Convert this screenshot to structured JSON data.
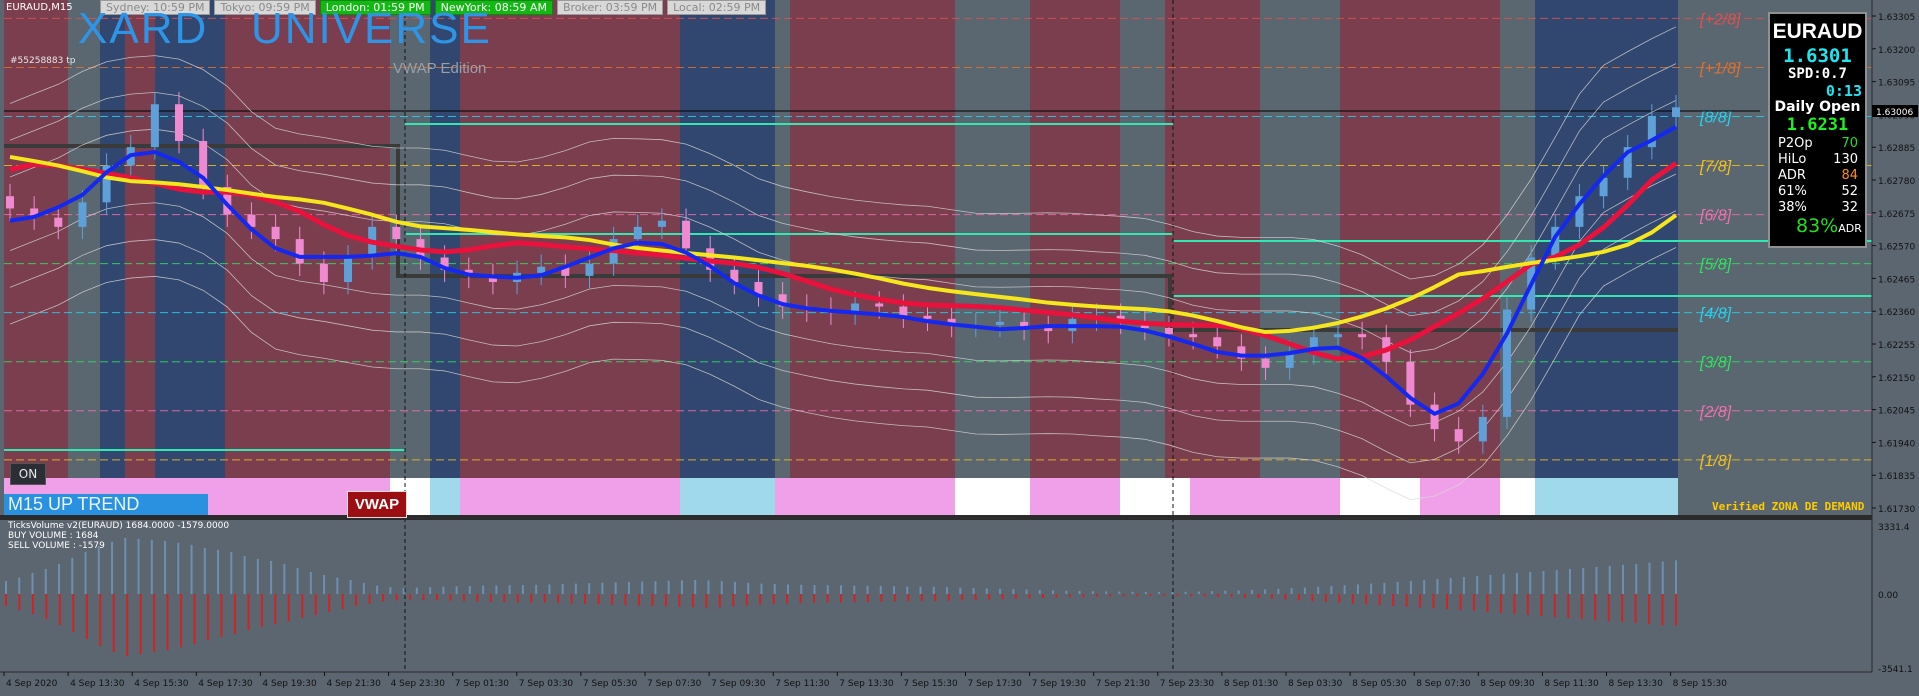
{
  "window": {
    "symbol_title": "EURAUD,M15",
    "brand_left": "XARD",
    "brand_right": "UNIVERSE",
    "brand_subtitle": "VWAP Edition",
    "account_label": "#55258883 tp",
    "on_button": "ON",
    "trend_label": "M15   UP TREND",
    "vwap_badge": "VWAP",
    "demand_label": "Verified ZONA DE DEMAND"
  },
  "sessions": [
    {
      "label": "Sydney: 10:59 PM",
      "active": false
    },
    {
      "label": "Tokyo: 09:59 PM",
      "active": false
    },
    {
      "label": "London: 01:59 PM",
      "active": true
    },
    {
      "label": "NewYork: 08:59 AM",
      "active": true
    },
    {
      "label": "Broker: 03:59 PM",
      "active": false
    },
    {
      "label": "Local: 02:59 PM",
      "active": false
    }
  ],
  "info_panel": {
    "symbol": "EURAUD",
    "price": "1.6301",
    "spread": "SPD:0.7",
    "time": "0:13",
    "daily_open_label": "Daily Open",
    "daily_open": "1.6231",
    "rows": [
      {
        "key": "P2Op",
        "value": "70",
        "color": "#20e020"
      },
      {
        "key": "HiLo",
        "value": "130",
        "color": "#ffffff"
      },
      {
        "key": "ADR",
        "value": "84",
        "color": "#ff8c1a"
      },
      {
        "key": "61%",
        "value": "52",
        "color": "#ffffff"
      },
      {
        "key": "38%",
        "value": "32",
        "color": "#ffffff"
      }
    ],
    "adr_pct": "83%",
    "adr_suffix": "ADR"
  },
  "chart_data": [
    {
      "type": "candlestick",
      "symbol": "EURAUD",
      "timeframe": "M15",
      "y_ticks": [
        "1.63305",
        "1.63200",
        "1.63095",
        "1.62990",
        "1.62885",
        "1.62780",
        "1.62675",
        "1.62570",
        "1.62465",
        "1.62360",
        "1.62255",
        "1.62150",
        "1.62045",
        "1.61940",
        "1.61835",
        "1.61730"
      ],
      "ylim": [
        1.6168,
        1.6336
      ],
      "current_price_tag": "1.63006",
      "x_ticks": [
        "4 Sep 2020",
        "4 Sep 13:30",
        "4 Sep 15:30",
        "4 Sep 17:30",
        "4 Sep 19:30",
        "4 Sep 21:30",
        "4 Sep 23:30",
        "7 Sep 01:30",
        "7 Sep 03:30",
        "7 Sep 05:30",
        "7 Sep 07:30",
        "7 Sep 09:30",
        "7 Sep 11:30",
        "7 Sep 13:30",
        "7 Sep 15:30",
        "7 Sep 17:30",
        "7 Sep 19:30",
        "7 Sep 21:30",
        "7 Sep 23:30",
        "8 Sep 01:30",
        "8 Sep 03:30",
        "8 Sep 05:30",
        "8 Sep 07:30",
        "8 Sep 09:30",
        "8 Sep 11:30",
        "8 Sep 13:30",
        "8 Sep 15:30"
      ],
      "murrey_levels": [
        {
          "label": "[+2/8]",
          "price": 1.633,
          "color": "#e05050"
        },
        {
          "label": "[+1/8]",
          "price": 1.6314,
          "color": "#e07030"
        },
        {
          "label": "[8/8]",
          "price": 1.6298,
          "color": "#28d0f0"
        },
        {
          "label": "[7/8]",
          "price": 1.6282,
          "color": "#f0c020"
        },
        {
          "label": "[6/8]",
          "price": 1.6266,
          "color": "#f070b0"
        },
        {
          "label": "[5/8]",
          "price": 1.625,
          "color": "#30e060"
        },
        {
          "label": "[4/8]",
          "price": 1.6234,
          "color": "#28d0f0"
        },
        {
          "label": "[3/8]",
          "price": 1.6218,
          "color": "#30e060"
        },
        {
          "label": "[2/8]",
          "price": 1.6202,
          "color": "#f070b0"
        },
        {
          "label": "[1/8]",
          "price": 1.6186,
          "color": "#f0c020"
        }
      ],
      "series": [
        {
          "kind": "close",
          "values": [
            1.6268,
            1.6265,
            1.6262,
            1.627,
            1.6282,
            1.6288,
            1.6302,
            1.629,
            1.6275,
            1.6266,
            1.6262,
            1.6258,
            1.625,
            1.6244,
            1.6252,
            1.6262,
            1.6258,
            1.6252,
            1.6248,
            1.6246,
            1.6244,
            1.6247,
            1.6249,
            1.6246,
            1.625,
            1.6258,
            1.6262,
            1.6264,
            1.6255,
            1.6248,
            1.6244,
            1.624,
            1.6236,
            1.6235,
            1.6234,
            1.6237,
            1.6236,
            1.6233,
            1.6232,
            1.623,
            1.623,
            1.6231,
            1.6229,
            1.6228,
            1.6232,
            1.6233,
            1.6231,
            1.6229,
            1.6227,
            1.6226,
            1.6223,
            1.6219,
            1.6216,
            1.6221,
            1.6226,
            1.6227,
            1.6226,
            1.6218,
            1.6204,
            1.6196,
            1.6192,
            1.62,
            1.6235,
            1.6252,
            1.6262,
            1.6272,
            1.6278,
            1.6288,
            1.6298,
            1.6301
          ]
        }
      ]
    },
    {
      "type": "bar",
      "title": "TicksVolume v2(EURAUD) 1684.0000 -1579.0000",
      "buy_label": "BUY VOLUME : 1684",
      "sell_label": "SELL VOLUME : -1579",
      "y_ticks": [
        "3331.4",
        "0.00",
        "-3541.1"
      ],
      "buy_values": [
        650,
        820,
        1050,
        1250,
        1500,
        1800,
        2100,
        2400,
        2600,
        2800,
        2750,
        2700,
        2650,
        2550,
        2450,
        2300,
        2200,
        2100,
        1900,
        1750,
        1650,
        1500,
        1300,
        1100,
        950,
        820,
        700,
        560,
        420,
        350,
        300,
        320,
        340,
        360,
        380,
        400,
        420,
        430,
        440,
        450,
        460,
        480,
        500,
        520,
        540,
        560,
        580,
        600,
        620,
        640,
        660,
        680,
        700,
        680,
        640,
        600,
        560,
        520,
        500,
        480,
        460,
        450,
        440,
        430,
        420,
        410,
        400,
        390,
        380,
        370,
        360,
        340,
        320,
        300,
        280,
        260,
        240,
        220,
        200,
        180,
        160,
        150,
        140,
        130,
        120,
        110,
        100,
        100,
        100,
        110,
        120,
        140,
        160,
        180,
        200,
        230,
        260,
        290,
        320,
        360,
        400,
        440,
        480,
        520,
        560,
        600,
        650,
        700,
        750,
        800,
        850,
        900,
        950,
        1000,
        1050,
        1100,
        1150,
        1200,
        1250,
        1300,
        1350,
        1400,
        1450,
        1500,
        1560,
        1620,
        1680
      ],
      "sell_values": [
        -600,
        -800,
        -1000,
        -1250,
        -1550,
        -1900,
        -2250,
        -2600,
        -2900,
        -3100,
        -3000,
        -2900,
        -2800,
        -2650,
        -2500,
        -2300,
        -2150,
        -2000,
        -1800,
        -1650,
        -1500,
        -1350,
        -1200,
        -1050,
        -900,
        -750,
        -600,
        -480,
        -380,
        -320,
        -280,
        -300,
        -320,
        -340,
        -360,
        -380,
        -400,
        -410,
        -420,
        -430,
        -440,
        -460,
        -480,
        -500,
        -520,
        -540,
        -560,
        -580,
        -600,
        -620,
        -640,
        -660,
        -680,
        -660,
        -620,
        -580,
        -540,
        -500,
        -480,
        -460,
        -440,
        -430,
        -420,
        -410,
        -400,
        -390,
        -380,
        -370,
        -360,
        -350,
        -340,
        -320,
        -300,
        -280,
        -260,
        -240,
        -220,
        -200,
        -180,
        -160,
        -150,
        -140,
        -130,
        -120,
        -110,
        -100,
        -100,
        -100,
        -110,
        -120,
        -140,
        -160,
        -180,
        -200,
        -240,
        -280,
        -320,
        -360,
        -400,
        -440,
        -480,
        -520,
        -560,
        -600,
        -640,
        -680,
        -720,
        -760,
        -800,
        -850,
        -900,
        -950,
        -1000,
        -1050,
        -1100,
        -1150,
        -1200,
        -1250,
        -1300,
        -1350,
        -1400,
        -1450,
        -1500,
        -1560,
        -1579
      ]
    }
  ],
  "colors": {
    "maroon": "#7a3e4e",
    "navy": "#31476f",
    "slate": "#5a6670",
    "bull": "#5fa0d8",
    "bear": "#f08ad0",
    "ma_red": "#e8123c",
    "ma_yellow": "#f6e61e",
    "ma_blue": "#1428f0",
    "buy_vol": "#6d8fb0",
    "sell_vol": "#d02424"
  }
}
